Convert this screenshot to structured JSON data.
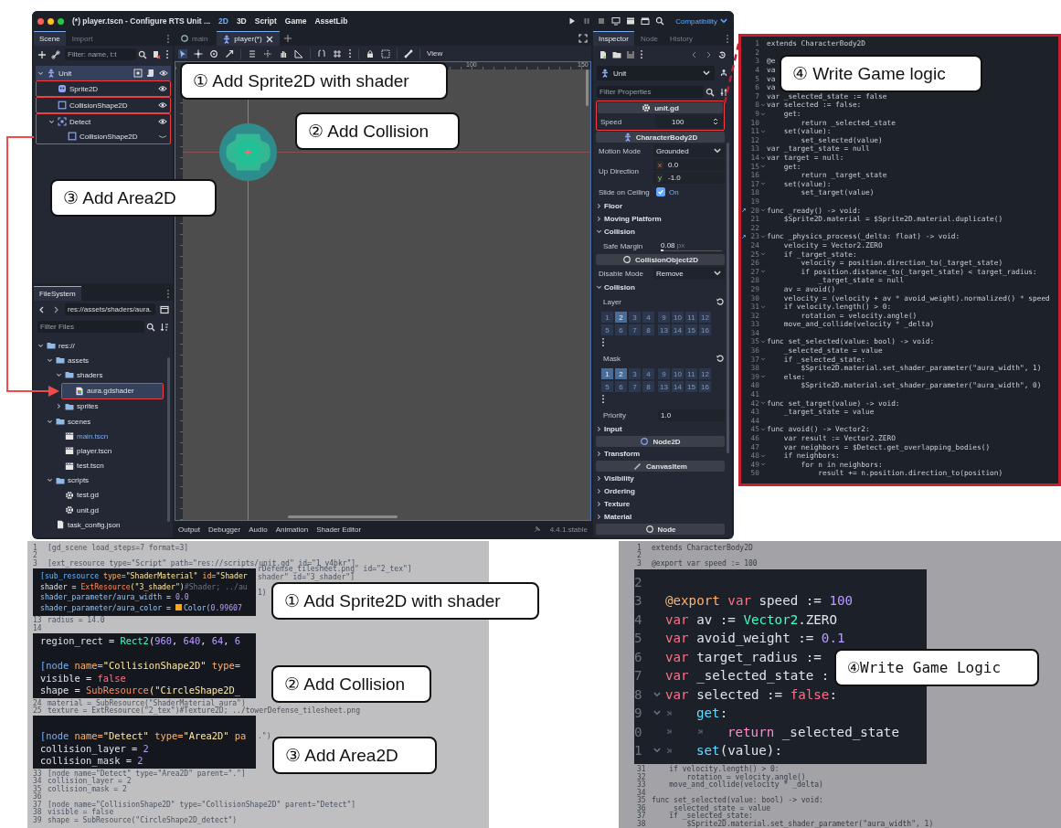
{
  "editor": {
    "title": "(*) player.tscn - Configure RTS Unit ...",
    "workspaces": [
      {
        "label": "2D",
        "selected": true
      },
      {
        "label": "3D",
        "selected": false
      },
      {
        "label": "Script",
        "selected": false
      },
      {
        "label": "Game",
        "selected": false
      },
      {
        "label": "AssetLib",
        "selected": false
      }
    ],
    "renderer": "Compatibility",
    "scene_dock": {
      "tabs": [
        {
          "label": "Scene",
          "selected": true
        },
        {
          "label": "Import",
          "selected": false
        }
      ],
      "filter_placeholder": "Filter: name, t:t",
      "tree": [
        {
          "label": "Unit",
          "kind": "body",
          "selected": true,
          "expanded": true,
          "annotated": false,
          "visible": true,
          "script": true,
          "grouped": true,
          "children": [
            {
              "label": "Sprite2D",
              "kind": "sprite",
              "selected": false,
              "annotated": true,
              "visible": true,
              "script": false,
              "grouped": false
            },
            {
              "label": "CollisionShape2D",
              "kind": "shape",
              "selected": false,
              "annotated": true,
              "visible": true,
              "script": false,
              "grouped": false
            },
            {
              "label": "Detect",
              "kind": "area",
              "selected": false,
              "expanded": true,
              "annotated": true,
              "visible": true,
              "script": false,
              "grouped": false,
              "children": [
                {
                  "label": "CollisionShape2D",
                  "kind": "shape",
                  "selected": false,
                  "annotated": false,
                  "visible": false,
                  "script": false,
                  "grouped": false
                }
              ]
            }
          ]
        }
      ]
    },
    "filesystem": {
      "tab": "FileSystem",
      "path": "res://assets/shaders/aura.",
      "filter_placeholder": "Filter Files",
      "tree": [
        {
          "label": "res://",
          "kind": "folder",
          "selected": false,
          "expanded": true,
          "children": [
            {
              "label": "assets",
              "kind": "folder",
              "selected": false,
              "expanded": true,
              "children": [
                {
                  "label": "shaders",
                  "kind": "folder",
                  "selected": false,
                  "expanded": true,
                  "children": [
                    {
                      "label": "aura.gdshader",
                      "kind": "shader",
                      "selected": true,
                      "annotated": true,
                      "current": false
                    }
                  ]
                },
                {
                  "label": "sprites",
                  "kind": "folder",
                  "selected": false,
                  "expanded": false
                }
              ]
            },
            {
              "label": "scenes",
              "kind": "folder",
              "selected": false,
              "expanded": true,
              "children": [
                {
                  "label": "main.tscn",
                  "kind": "scene",
                  "selected": false,
                  "current": true
                },
                {
                  "label": "player.tscn",
                  "kind": "scene",
                  "selected": false,
                  "current": false
                },
                {
                  "label": "test.tscn",
                  "kind": "scene",
                  "selected": false,
                  "current": false
                }
              ]
            },
            {
              "label": "scripts",
              "kind": "folder",
              "selected": false,
              "expanded": true,
              "children": [
                {
                  "label": "test.gd",
                  "kind": "script",
                  "selected": false,
                  "current": false
                },
                {
                  "label": "unit.gd",
                  "kind": "script",
                  "selected": false,
                  "current": false
                }
              ]
            },
            {
              "label": "task_config.json",
              "kind": "text",
              "selected": false,
              "current": false
            }
          ]
        }
      ]
    },
    "scene_tabs": [
      {
        "label": "main",
        "selected": false
      },
      {
        "label": "player(*)",
        "selected": true
      }
    ],
    "view_menu": "View",
    "ruler_labels": [
      "100",
      "150"
    ],
    "bottom_tabs": [
      "Output",
      "Debugger",
      "Audio",
      "Animation",
      "Shader Editor"
    ],
    "version": "4.4.1.stable",
    "inspector": {
      "tabs": [
        {
          "label": "Inspector",
          "selected": true
        },
        {
          "label": "Node",
          "selected": false
        },
        {
          "label": "History",
          "selected": false
        }
      ],
      "object": "Unit",
      "filter_placeholder": "Filter Properties",
      "properties": [
        {
          "kind": "script",
          "label": "unit.gd",
          "annotated": true,
          "props": [
            {
              "label": "Speed",
              "value": "100"
            }
          ]
        },
        {
          "kind": "header",
          "label": "CharacterBody2D"
        },
        {
          "kind": "select",
          "label": "Motion Mode",
          "value": "Grounded"
        },
        {
          "kind": "vector",
          "label": "Up Direction",
          "components": [
            {
              "axis": "x",
              "value": "0.0"
            },
            {
              "axis": "y",
              "value": "-1.0"
            }
          ]
        },
        {
          "kind": "check",
          "label": "Slide on Ceiling",
          "checked": true,
          "value": "On"
        },
        {
          "kind": "group",
          "label": "Floor",
          "expanded": false
        },
        {
          "kind": "group",
          "label": "Moving Platform",
          "expanded": false
        },
        {
          "kind": "group",
          "label": "Collision",
          "expanded": true
        },
        {
          "kind": "slider",
          "label": "Safe Margin",
          "value": "0.08",
          "unit": "px",
          "level": 0.05
        },
        {
          "kind": "header",
          "label": "CollisionObject2D"
        },
        {
          "kind": "select",
          "label": "Disable Mode",
          "value": "Remove"
        },
        {
          "kind": "group",
          "label": "Collision",
          "expanded": true
        },
        {
          "kind": "layers",
          "label": "Layer",
          "cells": [
            {
              "label": "1",
              "selected": false
            },
            {
              "label": "2",
              "selected": true
            },
            {
              "label": "3",
              "selected": false
            },
            {
              "label": "4",
              "selected": false
            },
            {
              "label": "9",
              "selected": false
            },
            {
              "label": "10",
              "selected": false
            },
            {
              "label": "11",
              "selected": false
            },
            {
              "label": "12",
              "selected": false
            },
            {
              "label": "5",
              "selected": false
            },
            {
              "label": "6",
              "selected": false
            },
            {
              "label": "7",
              "selected": false
            },
            {
              "label": "8",
              "selected": false
            },
            {
              "label": "13",
              "selected": false
            },
            {
              "label": "14",
              "selected": false
            },
            {
              "label": "15",
              "selected": false
            },
            {
              "label": "16",
              "selected": false
            }
          ]
        },
        {
          "kind": "layers",
          "label": "Mask",
          "cells": [
            {
              "label": "1",
              "selected": true
            },
            {
              "label": "2",
              "selected": true
            },
            {
              "label": "3",
              "selected": false
            },
            {
              "label": "4",
              "selected": false
            },
            {
              "label": "9",
              "selected": false
            },
            {
              "label": "10",
              "selected": false
            },
            {
              "label": "11",
              "selected": false
            },
            {
              "label": "12",
              "selected": false
            },
            {
              "label": "5",
              "selected": false
            },
            {
              "label": "6",
              "selected": false
            },
            {
              "label": "7",
              "selected": false
            },
            {
              "label": "8",
              "selected": false
            },
            {
              "label": "13",
              "selected": false
            },
            {
              "label": "14",
              "selected": false
            },
            {
              "label": "15",
              "selected": false
            },
            {
              "label": "16",
              "selected": false
            }
          ]
        },
        {
          "kind": "value",
          "label": "Priority",
          "value": "1.0"
        },
        {
          "kind": "group",
          "label": "Input",
          "expanded": false
        },
        {
          "kind": "header",
          "label": "Node2D"
        },
        {
          "kind": "group",
          "label": "Transform",
          "expanded": false
        },
        {
          "kind": "header",
          "label": "CanvasItem"
        },
        {
          "kind": "group",
          "label": "Visibility",
          "expanded": false
        },
        {
          "kind": "group",
          "label": "Ordering",
          "expanded": false
        },
        {
          "kind": "group",
          "label": "Texture",
          "expanded": false
        },
        {
          "kind": "group",
          "label": "Material",
          "expanded": false
        },
        {
          "kind": "header",
          "label": "Node"
        }
      ]
    }
  },
  "script_panel": {
    "lines": [
      {
        "n": "1",
        "text": "extends CharacterBody2D",
        "fold": false,
        "override": false
      },
      {
        "n": "2",
        "fold": false,
        "override": false
      },
      {
        "n": "3",
        "text": "@e",
        "fold": false,
        "override": false
      },
      {
        "n": "4",
        "text": "va",
        "fold": false,
        "override": false
      },
      {
        "n": "5",
        "text": "va",
        "fold": false,
        "override": false
      },
      {
        "n": "6",
        "text": "va",
        "fold": false,
        "override": false
      },
      {
        "n": "7",
        "text": "var _selected_state := false",
        "fold": false,
        "override": false
      },
      {
        "n": "8",
        "text": "var selected := false:",
        "fold": true,
        "override": false
      },
      {
        "n": "9",
        "text": "    get:",
        "fold": true,
        "override": false
      },
      {
        "n": "10",
        "text": "        return _selected_state",
        "fold": false,
        "override": false
      },
      {
        "n": "11",
        "text": "    set(value):",
        "fold": true,
        "override": false
      },
      {
        "n": "12",
        "text": "        set_selected(value)",
        "fold": false,
        "override": false
      },
      {
        "n": "13",
        "text": "var _target_state = null",
        "fold": false,
        "override": false
      },
      {
        "n": "14",
        "text": "var target = null:",
        "fold": true,
        "override": false
      },
      {
        "n": "15",
        "text": "    get:",
        "fold": true,
        "override": false
      },
      {
        "n": "16",
        "text": "        return _target_state",
        "fold": false,
        "override": false
      },
      {
        "n": "17",
        "text": "    set(value):",
        "fold": true,
        "override": false
      },
      {
        "n": "18",
        "text": "        set_target(value)",
        "fold": false,
        "override": false
      },
      {
        "n": "19",
        "fold": false,
        "override": false
      },
      {
        "n": "20",
        "text": "func _ready() -> void:",
        "fold": true,
        "override": true
      },
      {
        "n": "21",
        "text": "    $Sprite2D.material = $Sprite2D.material.duplicate()",
        "fold": false,
        "override": false
      },
      {
        "n": "22",
        "fold": false,
        "override": false
      },
      {
        "n": "23",
        "text": "func _physics_process(_delta: float) -> void:",
        "fold": true,
        "override": true
      },
      {
        "n": "24",
        "text": "    velocity = Vector2.ZERO",
        "fold": false,
        "override": false
      },
      {
        "n": "25",
        "text": "    if _target_state:",
        "fold": true,
        "override": false
      },
      {
        "n": "26",
        "text": "        velocity = position.direction_to(_target_state)",
        "fold": false,
        "override": false
      },
      {
        "n": "27",
        "text": "        if position.distance_to(_target_state) < target_radius:",
        "fold": true,
        "override": false
      },
      {
        "n": "28",
        "text": "            _target_state = null",
        "fold": false,
        "override": false
      },
      {
        "n": "29",
        "text": "    av = avoid()",
        "fold": false,
        "override": false
      },
      {
        "n": "30",
        "text": "    velocity = (velocity + av * avoid_weight).normalized() * speed",
        "fold": false,
        "override": false
      },
      {
        "n": "31",
        "text": "    if velocity.length() > 0:",
        "fold": true,
        "override": false
      },
      {
        "n": "32",
        "text": "        rotation = velocity.angle()",
        "fold": false,
        "override": false
      },
      {
        "n": "33",
        "text": "    move_and_collide(velocity * _delta)",
        "fold": false,
        "override": false
      },
      {
        "n": "34",
        "fold": false,
        "override": false
      },
      {
        "n": "35",
        "text": "func set_selected(value: bool) -> void:",
        "fold": true,
        "override": false
      },
      {
        "n": "36",
        "text": "    _selected_state = value",
        "fold": false,
        "override": false
      },
      {
        "n": "37",
        "text": "    if _selected_state:",
        "fold": true,
        "override": false
      },
      {
        "n": "38",
        "text": "        $Sprite2D.material.set_shader_parameter(\"aura_width\", 1)",
        "fold": false,
        "override": false
      },
      {
        "n": "39",
        "text": "    else:",
        "fold": true,
        "override": false
      },
      {
        "n": "40",
        "text": "        $Sprite2D.material.set_shader_parameter(\"aura_width\", 0)",
        "fold": false,
        "override": false
      },
      {
        "n": "41",
        "fold": false,
        "override": false
      },
      {
        "n": "42",
        "text": "func set_target(value) -> void:",
        "fold": true,
        "override": false
      },
      {
        "n": "43",
        "text": "    _target_state = value",
        "fold": false,
        "override": false
      },
      {
        "n": "44",
        "fold": false,
        "override": false
      },
      {
        "n": "45",
        "text": "func avoid() -> Vector2:",
        "fold": true,
        "override": false
      },
      {
        "n": "46",
        "text": "    var result := Vector2.ZERO",
        "fold": false,
        "override": false
      },
      {
        "n": "47",
        "text": "    var neighbors = $Detect.get_overlapping_bodies()",
        "fold": false,
        "override": false
      },
      {
        "n": "48",
        "text": "    if neighbors:",
        "fold": true,
        "override": false
      },
      {
        "n": "49",
        "text": "        for n in neighbors:",
        "fold": true,
        "override": false
      },
      {
        "n": "50",
        "text": "            result += n.position.direction_to(position)",
        "fold": false,
        "override": false
      }
    ]
  },
  "scene_file_panel": {
    "blocks": [
      {
        "kind": "line",
        "n": "1",
        "text": "[gd_scene load_steps=7 format=3]"
      },
      {
        "kind": "line",
        "n": "2"
      },
      {
        "kind": "line",
        "n": "3",
        "text": "[ext_resource type=\"Script\" path=\"res://scripts/unit.gd\" id=\"1_y4bkr\"]"
      },
      {
        "kind": "snippet",
        "lines": [
          {
            "kind": "code",
            "tail": "rDefense_tilesheet.png\" id=\"2_tex\"]",
            "tokens": [
              {
                "kind": "section",
                "text": "[sub_resource "
              },
              {
                "kind": "key",
                "text": "type="
              },
              {
                "kind": "string",
                "text": "\"ShaderMaterial\" "
              },
              {
                "kind": "key",
                "text": "id="
              },
              {
                "kind": "string",
                "text": "\"Shader"
              }
            ]
          },
          {
            "kind": "code",
            "tail": "shader\" id=\"3_shader\"]",
            "tokens": [
              {
                "kind": "plain",
                "text": "shader = "
              },
              {
                "kind": "func",
                "text": "ExtResource"
              },
              {
                "kind": "string",
                "text": "(\"3_shader\")"
              },
              {
                "kind": "comment",
                "text": "#Shader; ../au"
              }
            ]
          },
          {
            "kind": "code",
            "tokens": [
              {
                "kind": "prop",
                "text": "shader_parameter/aura_width"
              },
              {
                "kind": "plain",
                "text": " = "
              },
              {
                "kind": "number",
                "text": "0.0"
              }
            ]
          },
          {
            "kind": "code",
            "tail": "1)",
            "tokens": [
              {
                "kind": "prop",
                "text": "shader_parameter/aura_color"
              },
              {
                "kind": "plain",
                "text": " = "
              },
              {
                "kind": "swatch",
                "color": "#f5a623"
              },
              {
                "kind": "prop",
                "text": "Color("
              },
              {
                "kind": "number",
                "text": "0.99607"
              }
            ]
          }
        ]
      },
      {
        "kind": "line",
        "n": "13",
        "text": "radius = 14.0"
      },
      {
        "kind": "line",
        "n": "14"
      },
      {
        "kind": "snippet",
        "lines": [
          {
            "kind": "code",
            "tokens": [
              {
                "kind": "plain",
                "text": "region_rect = "
              },
              {
                "kind": "type",
                "text": "Rect2"
              },
              {
                "kind": "plain",
                "text": "("
              },
              {
                "kind": "number",
                "text": "960"
              },
              {
                "kind": "plain",
                "text": ", "
              },
              {
                "kind": "number",
                "text": "640"
              },
              {
                "kind": "plain",
                "text": ", "
              },
              {
                "kind": "number",
                "text": "64"
              },
              {
                "kind": "plain",
                "text": ", "
              },
              {
                "kind": "number",
                "text": "6"
              }
            ]
          },
          {
            "kind": "blank"
          },
          {
            "kind": "code",
            "tokens": [
              {
                "kind": "section",
                "text": "[node "
              },
              {
                "kind": "key",
                "text": "name="
              },
              {
                "kind": "string",
                "text": "\"CollisionShape2D\" "
              },
              {
                "kind": "key",
                "text": "type="
              }
            ]
          },
          {
            "kind": "code",
            "tokens": [
              {
                "kind": "plain",
                "text": "visible = "
              },
              {
                "kind": "keyword",
                "text": "false"
              }
            ]
          },
          {
            "kind": "code",
            "tokens": [
              {
                "kind": "plain",
                "text": "shape = "
              },
              {
                "kind": "func",
                "text": "SubResource"
              },
              {
                "kind": "string",
                "text": "(\"CircleShape2D_"
              }
            ]
          }
        ]
      },
      {
        "kind": "line",
        "n": "24",
        "text": "material = SubResource(\"ShaderMaterial_aura\")"
      },
      {
        "kind": "line",
        "n": "25",
        "text": "texture = ExtResource(\"2_tex\")#Texture2D; ../towerDefense_tilesheet.png"
      },
      {
        "kind": "snippet",
        "lines": [
          {
            "kind": "blank"
          },
          {
            "kind": "code",
            "tail": ".\")",
            "tokens": [
              {
                "kind": "section",
                "text": "[node "
              },
              {
                "kind": "key",
                "text": "name="
              },
              {
                "kind": "string",
                "text": "\"Detect\" "
              },
              {
                "kind": "key",
                "text": "type="
              },
              {
                "kind": "string",
                "text": "\"Area2D\" "
              },
              {
                "kind": "key",
                "text": "pa"
              }
            ]
          },
          {
            "kind": "code",
            "tokens": [
              {
                "kind": "plain",
                "text": "collision_layer = "
              },
              {
                "kind": "number",
                "text": "2"
              }
            ]
          },
          {
            "kind": "code",
            "tokens": [
              {
                "kind": "plain",
                "text": "collision_mask = "
              },
              {
                "kind": "number",
                "text": "2"
              }
            ]
          }
        ]
      },
      {
        "kind": "line",
        "n": "33",
        "text": "[node name=\"Detect\" type=\"Area2D\" parent=\".\"]"
      },
      {
        "kind": "line",
        "n": "34",
        "text": "collision_layer = 2"
      },
      {
        "kind": "line",
        "n": "35",
        "text": "collision_mask = 2"
      },
      {
        "kind": "line",
        "n": "36"
      },
      {
        "kind": "line",
        "n": "37",
        "text": "[node name=\"CollisionShape2D\" type=\"CollisionShape2D\" parent=\"Detect\"]"
      },
      {
        "kind": "line",
        "n": "38",
        "text": "visible = false"
      },
      {
        "kind": "line",
        "n": "39",
        "text": "shape = SubResource(\"CircleShape2D_detect\")"
      }
    ]
  },
  "script_zoom_panel": {
    "blocks": [
      {
        "kind": "line",
        "n": "1",
        "text": "extends CharacterBody2D"
      },
      {
        "kind": "line",
        "n": "2"
      },
      {
        "kind": "line",
        "n": "3",
        "text": "@export var speed := 100"
      },
      {
        "kind": "snippet",
        "lines": [
          {
            "n": "2",
            "fold": false
          },
          {
            "n": "3",
            "fold": false,
            "tokens": [
              {
                "kind": "annotation",
                "text": "@export "
              },
              {
                "kind": "keyword",
                "text": "var "
              },
              {
                "kind": "plain",
                "text": "speed := "
              },
              {
                "kind": "number",
                "text": "100"
              }
            ]
          },
          {
            "n": "4",
            "fold": false,
            "tokens": [
              {
                "kind": "keyword",
                "text": "var "
              },
              {
                "kind": "plain",
                "text": "av := "
              },
              {
                "kind": "type",
                "text": "Vector2"
              },
              {
                "kind": "plain",
                "text": ".ZERO"
              }
            ]
          },
          {
            "n": "5",
            "fold": false,
            "tokens": [
              {
                "kind": "keyword",
                "text": "var "
              },
              {
                "kind": "plain",
                "text": "avoid_weight := "
              },
              {
                "kind": "number",
                "text": "0.1"
              }
            ]
          },
          {
            "n": "6",
            "fold": false,
            "tokens": [
              {
                "kind": "keyword",
                "text": "var "
              },
              {
                "kind": "plain",
                "text": "target_radius :="
              }
            ]
          },
          {
            "n": "7",
            "fold": false,
            "tokens": [
              {
                "kind": "keyword",
                "text": "var "
              },
              {
                "kind": "plain",
                "text": "_selected_state :"
              }
            ]
          },
          {
            "n": "8",
            "fold": true,
            "tokens": [
              {
                "kind": "keyword",
                "text": "var "
              },
              {
                "kind": "plain",
                "text": "selected := "
              },
              {
                "kind": "keyword",
                "text": "false"
              },
              {
                "kind": "plain",
                "text": ":"
              }
            ]
          },
          {
            "n": "9",
            "fold": true,
            "tokens": [
              {
                "kind": "indent"
              },
              {
                "kind": "call",
                "text": "get"
              },
              {
                "kind": "plain",
                "text": ":"
              }
            ]
          },
          {
            "n": "0",
            "fold": false,
            "tokens": [
              {
                "kind": "indent"
              },
              {
                "kind": "indent"
              },
              {
                "kind": "control",
                "text": "return "
              },
              {
                "kind": "plain",
                "text": "_selected_state"
              }
            ]
          },
          {
            "n": "1",
            "fold": true,
            "tokens": [
              {
                "kind": "indent"
              },
              {
                "kind": "call",
                "text": "set"
              },
              {
                "kind": "plain",
                "text": "(value):"
              }
            ]
          }
        ]
      },
      {
        "kind": "line",
        "n": "31",
        "text": "    if velocity.length() > 0:"
      },
      {
        "kind": "line",
        "n": "32",
        "text": "        rotation = velocity.angle()"
      },
      {
        "kind": "line",
        "n": "33",
        "text": "    move_and_collide(velocity * _delta)"
      },
      {
        "kind": "line",
        "n": "34"
      },
      {
        "kind": "line",
        "n": "35",
        "text": "func set_selected(value: bool) -> void:"
      },
      {
        "kind": "line",
        "n": "36",
        "text": "    _selected_state = value"
      },
      {
        "kind": "line",
        "n": "37",
        "text": "    if _selected_state:"
      },
      {
        "kind": "line",
        "n": "38",
        "text": "        $Sprite2D.material.set_shader_parameter(\"aura_width\", 1)"
      }
    ]
  },
  "callouts_top": [
    "① Add Sprite2D with shader",
    "② Add Collision",
    "③ Add Area2D",
    "④ Write Game logic"
  ],
  "callouts_bottom": [
    "① Add Sprite2D with shader",
    "② Add Collision",
    "③ Add Area2D",
    "④Write Game Logic"
  ]
}
